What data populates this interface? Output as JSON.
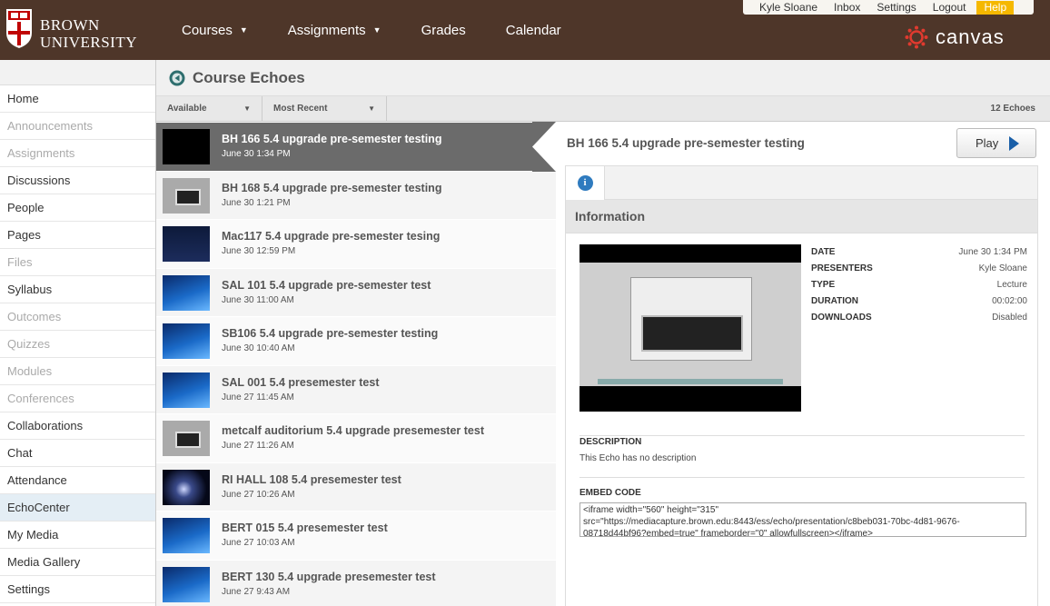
{
  "header": {
    "logo_line1": "BROWN",
    "logo_line2": "UNIVERSITY",
    "nav": [
      {
        "label": "Courses",
        "has_caret": true
      },
      {
        "label": "Assignments",
        "has_caret": true
      },
      {
        "label": "Grades",
        "has_caret": false
      },
      {
        "label": "Calendar",
        "has_caret": false
      }
    ],
    "user_nav": {
      "user": "Kyle Sloane",
      "inbox": "Inbox",
      "settings": "Settings",
      "logout": "Logout",
      "help": "Help"
    },
    "canvas_label": "canvas",
    "colors": {
      "header_bg": "#4e3629",
      "help_bg": "#f5b800",
      "canvas_red": "#e03a2f"
    }
  },
  "sidebar": {
    "items": [
      {
        "label": "Home",
        "state": "normal"
      },
      {
        "label": "Announcements",
        "state": "disabled"
      },
      {
        "label": "Assignments",
        "state": "disabled"
      },
      {
        "label": "Discussions",
        "state": "normal"
      },
      {
        "label": "People",
        "state": "normal"
      },
      {
        "label": "Pages",
        "state": "normal"
      },
      {
        "label": "Files",
        "state": "disabled"
      },
      {
        "label": "Syllabus",
        "state": "normal"
      },
      {
        "label": "Outcomes",
        "state": "disabled"
      },
      {
        "label": "Quizzes",
        "state": "disabled"
      },
      {
        "label": "Modules",
        "state": "disabled"
      },
      {
        "label": "Conferences",
        "state": "disabled"
      },
      {
        "label": "Collaborations",
        "state": "normal"
      },
      {
        "label": "Chat",
        "state": "normal"
      },
      {
        "label": "Attendance",
        "state": "normal"
      },
      {
        "label": "EchoCenter",
        "state": "active"
      },
      {
        "label": "My Media",
        "state": "normal"
      },
      {
        "label": "Media Gallery",
        "state": "normal"
      },
      {
        "label": "Settings",
        "state": "normal"
      }
    ]
  },
  "echo": {
    "page_title": "Course Echoes",
    "filter_available": "Available",
    "filter_sort": "Most Recent",
    "count": "12 Echoes",
    "list": [
      {
        "title": "BH 166 5.4 upgrade pre-semester testing",
        "date": "June 30 1:34 PM",
        "thumb": "black",
        "selected": true
      },
      {
        "title": "BH 168 5.4 upgrade pre-semester testing",
        "date": "June 30 1:21 PM",
        "thumb": "room",
        "selected": false
      },
      {
        "title": "Mac117 5.4 upgrade pre-semester tesing",
        "date": "June 30 12:59 PM",
        "thumb": "dark",
        "selected": false
      },
      {
        "title": "SAL 101 5.4 upgrade pre-semester test",
        "date": "June 30 11:00 AM",
        "thumb": "desk",
        "selected": false
      },
      {
        "title": "SB106 5.4 upgrade pre-semester testing",
        "date": "June 30 10:40 AM",
        "thumb": "desk",
        "selected": false
      },
      {
        "title": "SAL 001 5.4 presemester test",
        "date": "June 27 11:45 AM",
        "thumb": "desk",
        "selected": false
      },
      {
        "title": "metcalf auditorium 5.4 upgrade presemester test",
        "date": "June 27 11:26 AM",
        "thumb": "room",
        "selected": false
      },
      {
        "title": "RI HALL 108 5.4 presemester test",
        "date": "June 27 10:26 AM",
        "thumb": "space",
        "selected": false
      },
      {
        "title": "BERT 015 5.4 presemester test",
        "date": "June 27 10:03 AM",
        "thumb": "desk",
        "selected": false
      },
      {
        "title": "BERT 130 5.4 upgrade presemester test",
        "date": "June 27 9:43 AM",
        "thumb": "desk",
        "selected": false
      }
    ]
  },
  "detail": {
    "title": "BH 166 5.4 upgrade pre-semester testing",
    "play_label": "Play",
    "info_icon": "i",
    "info_heading": "Information",
    "meta": [
      {
        "key": "DATE",
        "value": "June 30 1:34 PM"
      },
      {
        "key": "PRESENTERS",
        "value": "Kyle Sloane"
      },
      {
        "key": "TYPE",
        "value": "Lecture"
      },
      {
        "key": "DURATION",
        "value": "00:02:00"
      },
      {
        "key": "DOWNLOADS",
        "value": "Disabled"
      }
    ],
    "description_label": "DESCRIPTION",
    "description_text": "This Echo has no description",
    "embed_label": "EMBED CODE",
    "embed_code": "<iframe width=\"560\" height=\"315\" src=\"https://mediacapture.brown.edu:8443/ess/echo/presentation/c8beb031-70bc-4d81-9676-08718d44bf96?embed=true\" frameborder=\"0\" allowfullscreen></iframe>"
  }
}
